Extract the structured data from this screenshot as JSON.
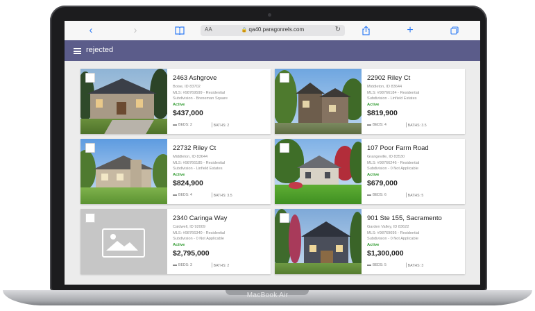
{
  "device": {
    "label": "MacBook Air"
  },
  "browser": {
    "url": "qa40.paragonrels.com",
    "text_size_label": "AA",
    "icons": [
      "back-icon",
      "forward-icon",
      "bookmarks-icon",
      "reload-icon",
      "share-icon",
      "new-tab-icon",
      "tabs-icon"
    ]
  },
  "header": {
    "title": "rejected",
    "color": "#5b5c8a"
  },
  "listings": [
    {
      "address": "2463 Ashgrove",
      "city": "Boise, ID 83702",
      "mls": "MLS: #98769599 - Residential",
      "subdivision": "Subdivision - Breneman Square",
      "status": "Active",
      "price": "$437,000",
      "beds": "BEDS: 2",
      "baths": "BATHS: 2"
    },
    {
      "address": "22902 Riley Ct",
      "city": "Middleton, ID 83644",
      "mls": "MLS: #98766184 - Residential",
      "subdivision": "Subdivision - Linfield Estates",
      "status": "Active",
      "price": "$819,900",
      "beds": "BEDS: 4",
      "baths": "BATHS: 3.5"
    },
    {
      "address": "22732 Riley Ct",
      "city": "Middleton, ID 83644",
      "mls": "MLS: #98766185 - Residential",
      "subdivision": "Subdivision - Linfield Estates",
      "status": "Active",
      "price": "$824,900",
      "beds": "BEDS: 4",
      "baths": "BATHS: 3.5"
    },
    {
      "address": "107 Poor Farm Road",
      "city": "Grangeville, ID 83530",
      "mls": "MLS: #98766246 - Residential",
      "subdivision": "Subdivision - 0 Not Applicable",
      "status": "Active",
      "price": "$679,000",
      "beds": "BEDS: 6",
      "baths": "BATHS: 5"
    },
    {
      "address": "2340 Caringa Way",
      "city": "Caldwell, ID 92009",
      "mls": "MLS: #98766340 - Residential",
      "subdivision": "Subdivision - 0 Not Applicable",
      "status": "Active",
      "price": "$2,795,000",
      "beds": "BEDS: 3",
      "baths": "BATHS: 2"
    },
    {
      "address": "901 Ste 155, Sacramento",
      "city": "Garden Valley, ID 83622",
      "mls": "MLS: #98769695 - Residential",
      "subdivision": "Subdivision - 0 Not Applicable",
      "status": "Active",
      "price": "$1,300,000",
      "beds": "BEDS: 5",
      "baths": "BATHS: 3"
    }
  ],
  "colors": {
    "status_active": "#2e9a2e",
    "accent": "#2f7cf6"
  }
}
